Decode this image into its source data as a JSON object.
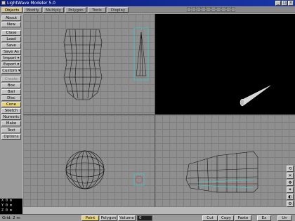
{
  "window": {
    "title": "LightWave Modeler 5.0",
    "buttons": [
      "_",
      "□",
      "×"
    ]
  },
  "tabs": [
    {
      "label": "Objects",
      "active": true
    },
    {
      "label": "Modify",
      "active": false
    },
    {
      "label": "Multiply",
      "active": false
    },
    {
      "label": "Polygon",
      "active": false
    },
    {
      "label": "Tools",
      "active": false
    },
    {
      "label": "Display",
      "active": false
    }
  ],
  "layers": {
    "foreground_active": [
      4
    ],
    "count": 20
  },
  "toolbar": {
    "items": [
      {
        "label": "About"
      },
      {
        "label": "New"
      },
      {
        "label": "Close"
      },
      {
        "label": "Load"
      },
      {
        "label": "Save"
      },
      {
        "label": "Save As"
      },
      {
        "label": "Import ▾"
      },
      {
        "label": "Export ▾"
      },
      {
        "label": "Custom ▾"
      },
      {
        "label": "Create",
        "dim": true
      },
      {
        "label": "Box"
      },
      {
        "label": "Ball"
      },
      {
        "label": "Disc"
      },
      {
        "label": "Cone",
        "active": true
      },
      {
        "label": "Sketch"
      },
      {
        "label": "Numeric"
      },
      {
        "label": "Make"
      },
      {
        "label": "Text"
      },
      {
        "label": "Options"
      }
    ]
  },
  "readout": {
    "line1": "X 0 m",
    "line2": "Y 0 m",
    "line3": "Z 0 m"
  },
  "status": {
    "grid_label": "Grid: 2 m",
    "modes": [
      {
        "label": "Point",
        "active": true
      },
      {
        "label": "Polygon",
        "active": false
      },
      {
        "label": "Volume",
        "active": false
      }
    ],
    "field_value": "0",
    "buttons": [
      "Cut",
      "Copy",
      "Paste",
      "Ex",
      "Un"
    ]
  },
  "colors": {
    "selected_yellow": "#e6d27b",
    "viewport_grid": "#8f8f8f",
    "wire": "#111111",
    "selection_cyan": "#3ec9c9"
  },
  "right_icons": [
    "rotate-view-icon",
    "zoom-icon",
    "move-view-icon",
    "light-icon",
    "render-icon",
    "settings-icon"
  ]
}
